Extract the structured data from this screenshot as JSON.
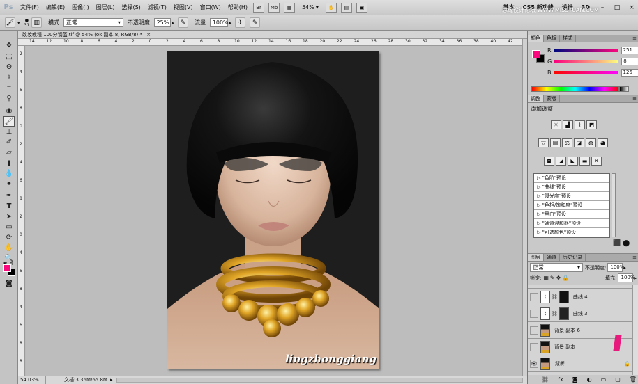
{
  "app": {
    "logo": "Ps"
  },
  "menu": [
    "文件(F)",
    "编辑(E)",
    "图像(I)",
    "图层(L)",
    "选择(S)",
    "滤镜(T)",
    "视图(V)",
    "窗口(W)",
    "帮助(H)"
  ],
  "menubar_controls": {
    "br_label": "Br",
    "mb_label": "Mb",
    "zoom": "54%"
  },
  "workspace": {
    "basic": "基本",
    "cs5": "CS5 新功能",
    "design": "设计",
    "threed": "3D"
  },
  "watermark": "思缘设计论坛 WWW.MISSYUAN.COM",
  "options": {
    "brush_size": "31",
    "mode_label": "模式:",
    "mode_value": "正常",
    "opacity_label": "不透明度:",
    "opacity_value": "25%",
    "flow_label": "流量:",
    "flow_value": "100%"
  },
  "document": {
    "tab_title": "改妆教程 100分钢盔.tif @ 54% (ok 副本 8, RGB/8) *",
    "ruler_top": [
      "14",
      "12",
      "10",
      "8",
      "6",
      "4",
      "2",
      "0",
      "2",
      "4",
      "6",
      "8",
      "10",
      "12",
      "14",
      "16",
      "18",
      "20",
      "22",
      "24",
      "26",
      "28",
      "30",
      "32",
      "34",
      "36",
      "38",
      "40",
      "42"
    ],
    "ruler_left": [
      "2",
      "4",
      "6",
      "8",
      "0",
      "2",
      "4",
      "6",
      "8",
      "2",
      "0",
      "4",
      "6",
      "8",
      "4",
      "6",
      "8",
      "8"
    ],
    "signature": "lingzhonggiang",
    "status_zoom": "54.03%",
    "status_doc": "文档:3.36M/65.8M"
  },
  "color_panel": {
    "tabs": [
      "颜色",
      "色板",
      "样式"
    ],
    "r_label": "R",
    "g_label": "G",
    "b_label": "B",
    "r_value": "251",
    "g_value": "8",
    "b_value": "126",
    "foreground": "#fb087e"
  },
  "adjustments": {
    "tabs": [
      "调整",
      "蒙版"
    ],
    "title": "添加调整",
    "presets": [
      "\"色阶\"预设",
      "\"曲线\"预设",
      "\"曝光度\"预设",
      "\"色相/饱和度\"预设",
      "\"黑白\"预设",
      "\"通道混和器\"预设",
      "\"可选颜色\"预设"
    ]
  },
  "layers": {
    "tabs": [
      "图层",
      "通道",
      "历史记录"
    ],
    "blend_mode": "正常",
    "opacity_label": "不透明度:",
    "opacity_value": "100%",
    "lock_label": "锁定:",
    "fill_label": "填充:",
    "fill_value": "100%",
    "items": [
      "曲线 4",
      "曲线 3",
      "背景 副本 6",
      "背景 副本",
      "背景"
    ]
  }
}
